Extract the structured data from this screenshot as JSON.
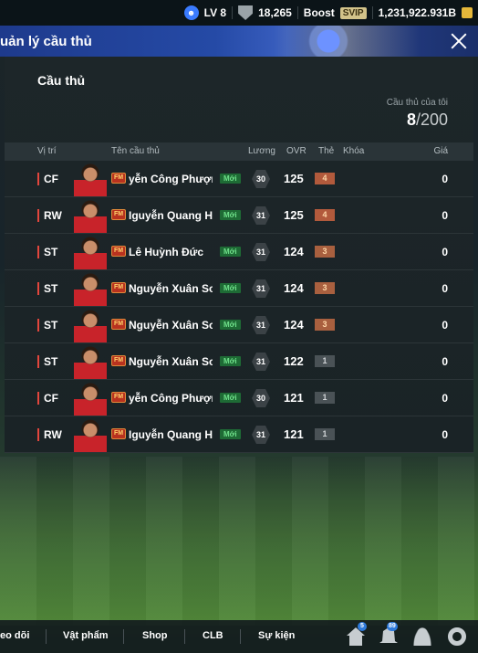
{
  "topbar": {
    "level": "LV 8",
    "trophies": "18,265",
    "boost_label": "Boost",
    "svip": "SVIP",
    "currency": "1,231,922.931B"
  },
  "header": {
    "title": "uản lý cầu thủ"
  },
  "panel": {
    "title": "Cầu thủ",
    "mine_label": "Cầu thủ của tôi",
    "mine_count": "8",
    "mine_max": "/200"
  },
  "columns": {
    "position": "Vị trí",
    "name": "Tên cầu thủ",
    "salary": "Lương",
    "ovr": "OVR",
    "grade": "Thẻ",
    "lock": "Khóa",
    "price": "Giá"
  },
  "players": [
    {
      "pos": "CF",
      "name": "yễn Công Phượng",
      "badge": "Mới",
      "salary": "30",
      "ovr": "125",
      "grade": "4",
      "price": "0"
    },
    {
      "pos": "RW",
      "name": "Iguyễn Quang Hải",
      "badge": "Mới",
      "salary": "31",
      "ovr": "125",
      "grade": "4",
      "price": "0"
    },
    {
      "pos": "ST",
      "name": "Lê Huỳnh Đức",
      "badge": "Mới",
      "salary": "31",
      "ovr": "124",
      "grade": "3",
      "price": "0"
    },
    {
      "pos": "ST",
      "name": "Nguyễn Xuân Son",
      "badge": "Mới",
      "salary": "31",
      "ovr": "124",
      "grade": "3",
      "price": "0"
    },
    {
      "pos": "ST",
      "name": "Nguyễn Xuân Son",
      "badge": "Mới",
      "salary": "31",
      "ovr": "124",
      "grade": "3",
      "price": "0"
    },
    {
      "pos": "ST",
      "name": "Nguyễn Xuân Son",
      "badge": "Mới",
      "salary": "31",
      "ovr": "122",
      "grade": "1",
      "price": "0"
    },
    {
      "pos": "CF",
      "name": "yễn Công Phượng",
      "badge": "Mới",
      "salary": "30",
      "ovr": "121",
      "grade": "1",
      "price": "0"
    },
    {
      "pos": "RW",
      "name": "Iguyễn Quang Hải",
      "badge": "Mới",
      "salary": "31",
      "ovr": "121",
      "grade": "1",
      "price": "0"
    }
  ],
  "bottomnav": {
    "items": [
      "eo dõi",
      "Vật phẩm",
      "Shop",
      "CLB",
      "Sự kiện"
    ],
    "home_badge": "5",
    "bell_badge": "89"
  }
}
